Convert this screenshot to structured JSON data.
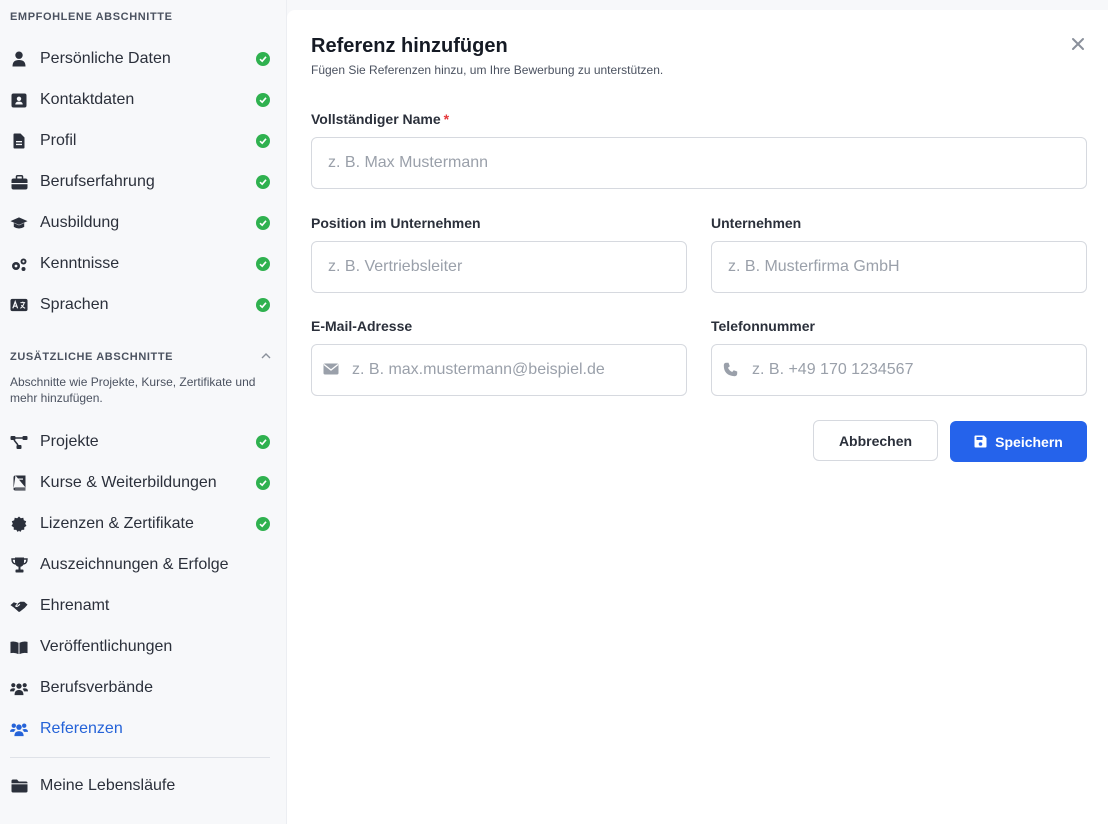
{
  "sidebar": {
    "recommended_title": "EMPFOHLENE ABSCHNITTE",
    "recommended": [
      {
        "label": "Persönliche Daten",
        "icon": "user-icon",
        "done": true
      },
      {
        "label": "Kontaktdaten",
        "icon": "contact-card-icon",
        "done": true
      },
      {
        "label": "Profil",
        "icon": "document-icon",
        "done": true
      },
      {
        "label": "Berufserfahrung",
        "icon": "briefcase-icon",
        "done": true
      },
      {
        "label": "Ausbildung",
        "icon": "graduation-cap-icon",
        "done": true
      },
      {
        "label": "Kenntnisse",
        "icon": "gears-icon",
        "done": true
      },
      {
        "label": "Sprachen",
        "icon": "language-icon",
        "done": true
      }
    ],
    "additional_title": "ZUSÄTZLICHE ABSCHNITTE",
    "additional_desc": "Abschnitte wie Projekte, Kurse, Zertifikate und mehr hinzufügen.",
    "additional": [
      {
        "label": "Projekte",
        "icon": "diagram-icon",
        "done": true
      },
      {
        "label": "Kurse & Weiterbildungen",
        "icon": "book-icon",
        "done": true
      },
      {
        "label": "Lizenzen & Zertifikate",
        "icon": "certificate-icon",
        "done": true
      },
      {
        "label": "Auszeichnungen & Erfolge",
        "icon": "trophy-icon",
        "done": false
      },
      {
        "label": "Ehrenamt",
        "icon": "handshake-icon",
        "done": false
      },
      {
        "label": "Veröffentlichungen",
        "icon": "open-book-icon",
        "done": false
      },
      {
        "label": "Berufsverbände",
        "icon": "people-group-icon",
        "done": false
      },
      {
        "label": "Referenzen",
        "icon": "users-icon",
        "done": false,
        "active": true
      }
    ],
    "footer_item": {
      "label": "Meine Lebensläufe",
      "icon": "folder-icon"
    }
  },
  "form": {
    "title": "Referenz hinzufügen",
    "subtitle": "Fügen Sie Referenzen hinzu, um Ihre Bewerbung zu unterstützen.",
    "name_label": "Vollständiger Name",
    "name_required_mark": "*",
    "name_placeholder": "z. B. Max Mustermann",
    "position_label": "Position im Unternehmen",
    "position_placeholder": "z. B. Vertriebsleiter",
    "company_label": "Unternehmen",
    "company_placeholder": "z. B. Musterfirma GmbH",
    "email_label": "E-Mail-Adresse",
    "email_placeholder": "z. B. max.mustermann@beispiel.de",
    "phone_label": "Telefonnummer",
    "phone_placeholder": "z. B. +49 170 1234567",
    "cancel_label": "Abbrechen",
    "save_label": "Speichern"
  },
  "colors": {
    "accent": "#2563eb",
    "active_nav": "#2563d8",
    "check": "#2fb14f",
    "required": "#e5383b"
  }
}
